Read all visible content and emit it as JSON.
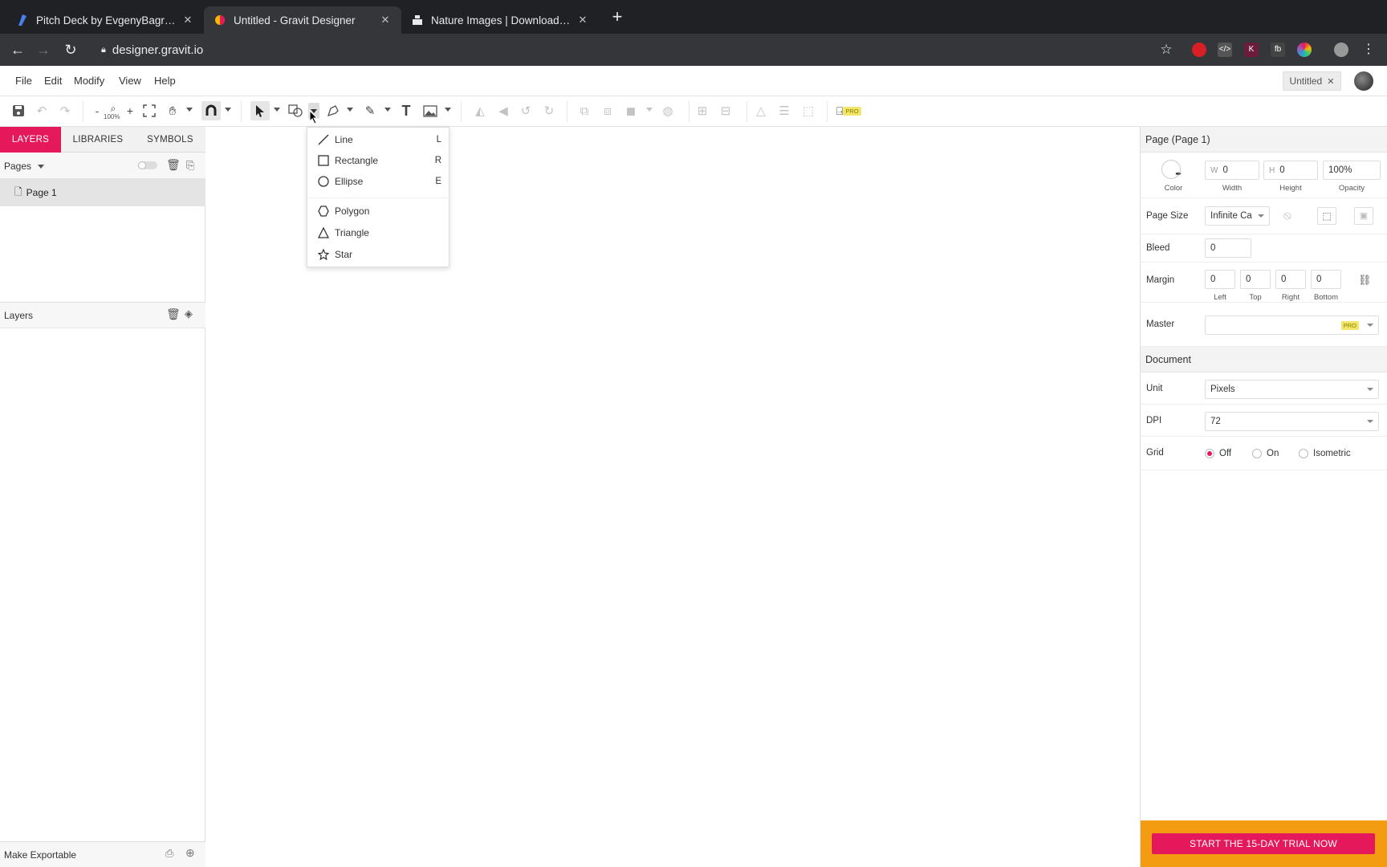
{
  "browser": {
    "tabs": [
      {
        "title": "Pitch Deck by EvgenyBagro | G",
        "favicon": "figma-like-icon"
      },
      {
        "title": "Untitled - Gravit Designer",
        "favicon": "gravit-icon"
      },
      {
        "title": "Nature Images | Download Fre",
        "favicon": "unsplash-icon"
      }
    ],
    "url": "designer.gravit.io"
  },
  "menubar": {
    "items": [
      "File",
      "Edit",
      "Modify",
      "View",
      "Help"
    ],
    "doc_tab": "Untitled"
  },
  "toolbar": {
    "zoom_label": "100%",
    "zoom_minus": "-",
    "zoom_plus": "+",
    "pro_badge": "PRO"
  },
  "left_panel": {
    "tabs": [
      "LAYERS",
      "LIBRARIES",
      "SYMBOLS"
    ],
    "pages_label": "Pages",
    "page_name": "Page 1",
    "layers_label": "Layers",
    "make_exportable": "Make Exportable"
  },
  "shape_menu": {
    "items": [
      {
        "label": "Line",
        "shortcut": "L",
        "icon": "line-icon"
      },
      {
        "label": "Rectangle",
        "shortcut": "R",
        "icon": "rectangle-icon"
      },
      {
        "label": "Ellipse",
        "shortcut": "E",
        "icon": "ellipse-icon"
      },
      {
        "label": "Polygon",
        "shortcut": "",
        "icon": "polygon-icon"
      },
      {
        "label": "Triangle",
        "shortcut": "",
        "icon": "triangle-icon"
      },
      {
        "label": "Star",
        "shortcut": "",
        "icon": "star-icon"
      }
    ]
  },
  "right_panel": {
    "title": "Page (Page 1)",
    "color_label": "Color",
    "width_prefix": "W",
    "width_value": "0",
    "width_label": "Width",
    "height_prefix": "H",
    "height_value": "0",
    "height_label": "Height",
    "opacity_value": "100%",
    "opacity_label": "Opacity",
    "page_size_label": "Page Size",
    "page_size_value": "Infinite Ca",
    "bleed_label": "Bleed",
    "bleed_value": "0",
    "margin_label": "Margin",
    "margins": [
      {
        "value": "0",
        "label": "Left"
      },
      {
        "value": "0",
        "label": "Top"
      },
      {
        "value": "0",
        "label": "Right"
      },
      {
        "value": "0",
        "label": "Bottom"
      }
    ],
    "master_label": "Master",
    "master_badge": "PRO",
    "document_title": "Document",
    "unit_label": "Unit",
    "unit_value": "Pixels",
    "dpi_label": "DPI",
    "dpi_value": "72",
    "grid_label": "Grid",
    "grid_options": [
      "Off",
      "On",
      "Isometric"
    ],
    "grid_selected": "Off",
    "trial_button": "START THE 15-DAY TRIAL NOW"
  },
  "colors": {
    "accent": "#e6185c",
    "trial_bg": "#f39c12",
    "chrome_dark": "#202124"
  }
}
